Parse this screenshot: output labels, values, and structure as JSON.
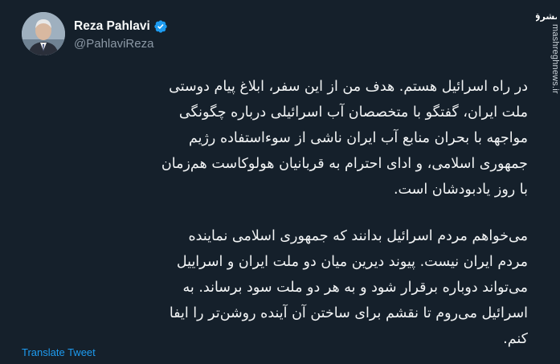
{
  "author": {
    "display_name": "Reza Pahlavi",
    "handle": "@PahlaviReza",
    "verified": true
  },
  "tweet": {
    "paragraph1_lines": [
      "در راه اسرائیل هستم. هدف من از این سفر، ابلاغ پیام دوستی",
      "ملت ایران، گفتگو با متخصصان آب اسرائیلی درباره چگونگی",
      "مواجهه با بحران منابع آب ایران ناشی از سوءاستفاده رژیم",
      "جمهوری اسلامی، و ادای احترام به قربانیان هولوکاست هم‌زمان",
      "با روز یادبودشان است."
    ],
    "paragraph2_lines": [
      "می‌خواهم مردم اسرائیل بدانند که جمهوری اسلامی نماینده",
      "مردم ایران نیست. پیوند دیرین میان دو ملت ایران و اسراییل",
      "می‌تواند دوباره برقرار شود و به هر دو ملت سود برساند. به",
      "اسرائیل می‌روم تا نقشم برای ساختن آن آینده روشن‌تر را ایفا",
      "کنم."
    ],
    "translate_label": "Translate Tweet"
  },
  "watermark": {
    "logo_text": "مشرق",
    "site": "mashreghnews.ir"
  },
  "colors": {
    "background": "#15202b",
    "text": "#f7f9f9",
    "secondary": "#8b98a5",
    "link": "#1d9bf0",
    "verified": "#1d9bf0"
  },
  "icons": {
    "verified": "verified-badge-icon",
    "logo": "mashregh-logo"
  }
}
